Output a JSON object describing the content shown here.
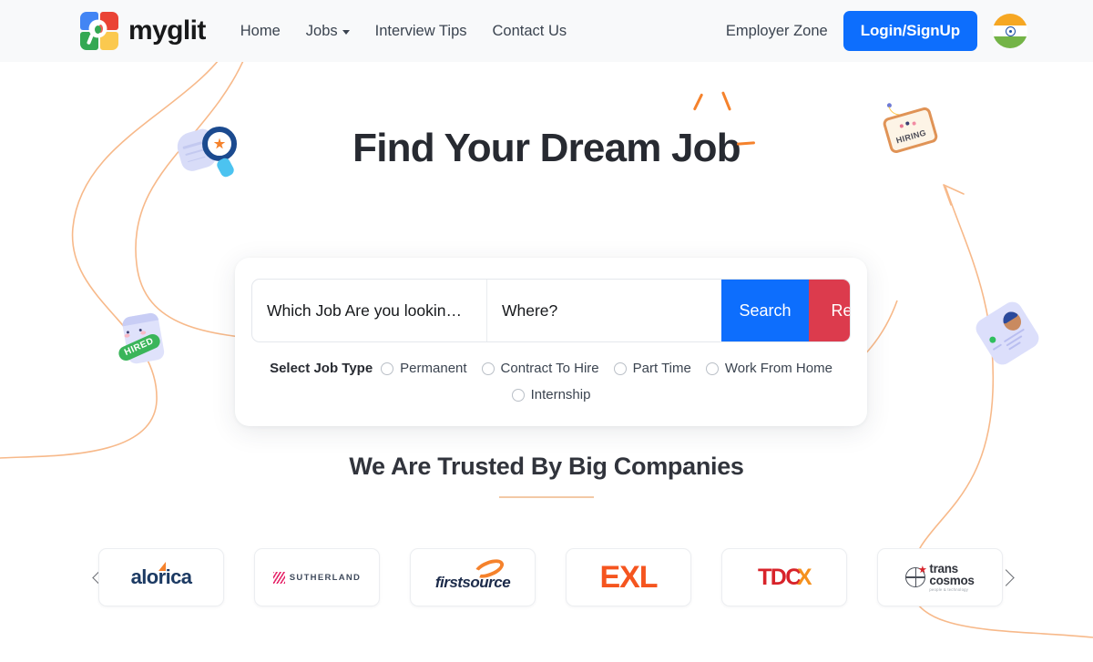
{
  "header": {
    "brand_name": "myglit",
    "logo_icon": "myglit-logo-icon",
    "nav": [
      {
        "label": "Home",
        "has_caret": false
      },
      {
        "label": "Jobs",
        "has_caret": true
      },
      {
        "label": "Interview Tips",
        "has_caret": false
      },
      {
        "label": "Contact Us",
        "has_caret": false
      }
    ],
    "employer_zone": "Employer Zone",
    "login_button": "Login/SignUp",
    "flag_icon": "india-flag-icon",
    "background": "#f8f9fa"
  },
  "hero": {
    "title": "Find Your Dream Job",
    "spark_color": "#f5822c"
  },
  "search": {
    "job_placeholder": "Which Job Are you lookin…",
    "job_value": "",
    "where_placeholder": "Where?",
    "where_value": "",
    "search_label": "Search",
    "reset_label": "Reset",
    "search_color": "#0d6efd",
    "reset_color": "#dc3b4d",
    "job_type_label": "Select Job Type",
    "job_types_row1": [
      "Permanent",
      "Contract To Hire",
      "Part Time",
      "Work From Home"
    ],
    "job_types_row2": [
      "Internship"
    ]
  },
  "trusted": {
    "title": "We Are Trusted By Big Companies",
    "divider_color": "#f3c9a6",
    "prev_arrow": "chevron-left-icon",
    "next_arrow": "chevron-right-icon",
    "companies": [
      {
        "name": "alorica",
        "mark": "alorica-logo"
      },
      {
        "name": "SUTHERLAND",
        "mark": "sutherland-logo"
      },
      {
        "name": "firstsource",
        "mark": "firstsource-logo"
      },
      {
        "name": "EXL",
        "mark": "exl-logo"
      },
      {
        "name": "TDCX",
        "mark": "tdcx-logo"
      },
      {
        "name": "transcosmos",
        "mark": "transcosmos-logo",
        "line1": "trans",
        "line2": "cosmos",
        "tagline": "people & technology"
      }
    ]
  },
  "decorations": {
    "curve_color": "#f7b98a",
    "magnifier_illustration": "magnifier-hand-illustration",
    "hired_badge": "HIRED",
    "hiring_sign": "HIRING",
    "profile_card": "profile-card-illustration"
  }
}
